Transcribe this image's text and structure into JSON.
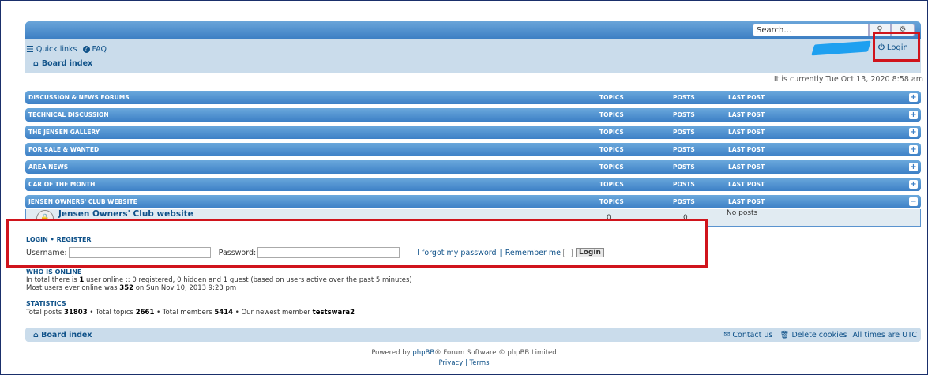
{
  "header": {
    "search_placeholder": "Search…",
    "search_icon": "magnifier-icon",
    "advanced_search_icon": "gear-icon"
  },
  "nav": {
    "quick_links": "Quick links",
    "faq": "FAQ",
    "board_index": "Board index",
    "login": "Login"
  },
  "current_time": "It is currently Tue Oct 13, 2020 8:58 am",
  "forum_headers": {
    "topics": "TOPICS",
    "posts": "POSTS",
    "last_post": "LAST POST"
  },
  "forums": [
    {
      "name": "DISCUSSION & NEWS FORUMS",
      "toggle": "+"
    },
    {
      "name": "TECHNICAL DISCUSSION",
      "toggle": "+"
    },
    {
      "name": "THE JENSEN GALLERY",
      "toggle": "+"
    },
    {
      "name": "FOR SALE & WANTED",
      "toggle": "+"
    },
    {
      "name": "AREA NEWS",
      "toggle": "+"
    },
    {
      "name": "CAR OF THE MONTH",
      "toggle": "+"
    },
    {
      "name": "JENSEN OWNERS' CLUB WEBSITE",
      "toggle": "−"
    }
  ],
  "expanded_forum": {
    "title": "Jensen Owners' Club website",
    "topics": "0",
    "posts": "0",
    "last_post": "No posts"
  },
  "login_form": {
    "heading_login": "LOGIN",
    "heading_sep": "•",
    "heading_register": "REGISTER",
    "username_label": "Username:",
    "password_label": "Password:",
    "forgot": "I forgot my password",
    "separator": "|",
    "remember": "Remember me",
    "submit": "Login"
  },
  "who_is_online": {
    "title": "WHO IS ONLINE",
    "line1_a": "In total there is ",
    "line1_count": "1",
    "line1_b": " user online :: 0 registered, 0 hidden and 1 guest (based on users active over the past 5 minutes)",
    "line2_a": "Most users ever online was ",
    "line2_count": "352",
    "line2_b": " on Sun Nov 10, 2013 9:23 pm"
  },
  "statistics": {
    "title": "STATISTICS",
    "posts_label": "Total posts ",
    "posts": "31803",
    "topics_label": " • Total topics ",
    "topics": "2661",
    "members_label": " • Total members ",
    "members": "5414",
    "newest_label": " • Our newest member ",
    "newest": "testswara2"
  },
  "footer": {
    "board_index": "Board index",
    "contact": "Contact us",
    "delete_cookies": "Delete cookies",
    "timezone": "All times are UTC",
    "powered_by_a": "Powered by ",
    "phpbb": "phpBB",
    "powered_by_b": "® Forum Software © phpBB Limited",
    "privacy": "Privacy",
    "sep": "|",
    "terms": "Terms"
  },
  "colors": {
    "header_blue": "#3d80c6",
    "nav_bg": "#cadceb",
    "link": "#105289",
    "highlight_red": "#d0141c"
  }
}
